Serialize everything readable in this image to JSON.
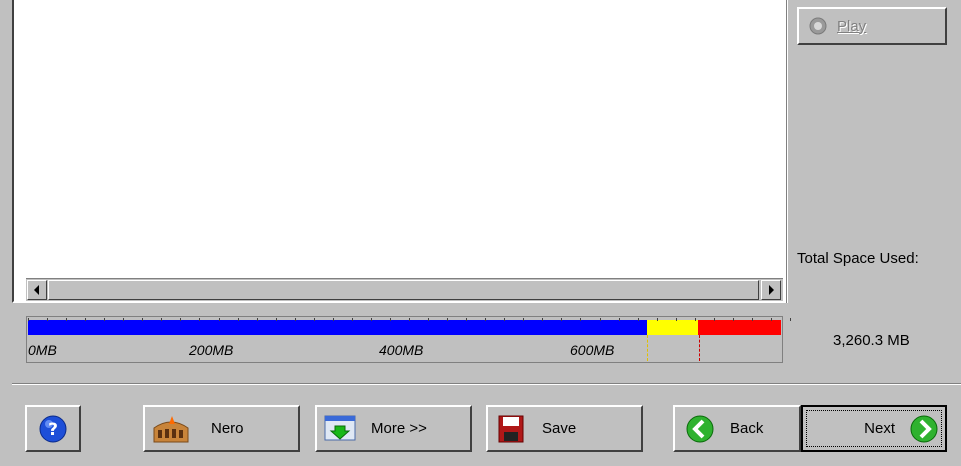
{
  "play_button": {
    "label": "Play",
    "disabled": true
  },
  "space": {
    "label": "Total Space Used:",
    "value": "3,260.3 MB"
  },
  "capacity_bar": {
    "scale_labels": [
      "0MB",
      "200MB",
      "400MB",
      "600MB"
    ],
    "blue_fraction": 0.822,
    "yellow_fraction": 0.068,
    "red_fraction": 0.11,
    "colors": {
      "blue": "#0000ff",
      "yellow": "#ffff00",
      "red": "#ff0000"
    }
  },
  "footer": {
    "help_icon": "help-icon",
    "nero_label": "Nero",
    "more_label": "More >>",
    "save_label": "Save",
    "back_label": "Back",
    "next_label": "Next"
  }
}
